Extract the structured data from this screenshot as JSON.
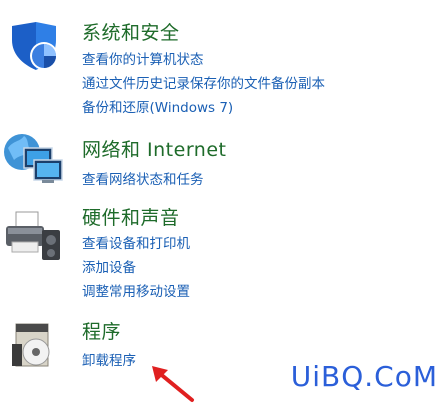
{
  "categories": [
    {
      "title": "系统和安全",
      "icon": "shield-icon",
      "links": [
        "查看你的计算机状态",
        "通过文件历史记录保存你的文件备份副本",
        "备份和还原(Windows 7)"
      ]
    },
    {
      "title": "网络和 Internet",
      "icon": "network-globe-icon",
      "links": [
        "查看网络状态和任务"
      ]
    },
    {
      "title": "硬件和声音",
      "icon": "printer-icon",
      "links": [
        "查看设备和打印机",
        "添加设备",
        "调整常用移动设置"
      ]
    },
    {
      "title": "程序",
      "icon": "programs-disc-icon",
      "links": [
        "卸载程序"
      ]
    }
  ],
  "watermark": "UiBQ.CoM",
  "colors": {
    "title": "#1e6b2a",
    "link": "#1a5fb4",
    "arrow": "#e02020",
    "watermark": "#2b5fd9"
  }
}
